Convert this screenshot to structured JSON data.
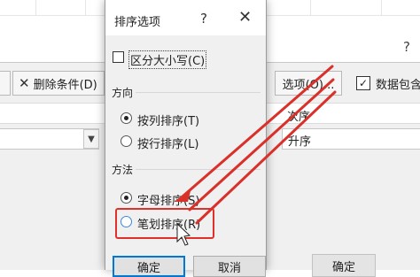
{
  "background": {
    "help_glyph": "?",
    "delete_condition_label": "删除条件(D)",
    "delete_icon": "x-icon",
    "options_button_label": "选项(O)...",
    "has_headers_label": "数据包含",
    "has_headers_checked": true,
    "order_header_label": "次序",
    "order_value": "升序",
    "ok_label": "确定"
  },
  "dialog": {
    "title": "排序选项",
    "help_glyph": "?",
    "close_glyph": "✕",
    "case_sensitive_label": "区分大小写(C)",
    "case_sensitive_checked": false,
    "direction_group_label": "方向",
    "direction_options": [
      {
        "label": "按列排序(T)",
        "selected": true
      },
      {
        "label": "按行排序(L)",
        "selected": false
      }
    ],
    "method_group_label": "方法",
    "method_options": [
      {
        "label": "字母排序(S)",
        "selected": true
      },
      {
        "label": "笔划排序(R)",
        "selected": false
      }
    ],
    "ok_label": "确定",
    "cancel_label": "取消"
  },
  "annotation": {
    "arrow_color": "#d9302a",
    "highlight_color": "#e0302a"
  }
}
